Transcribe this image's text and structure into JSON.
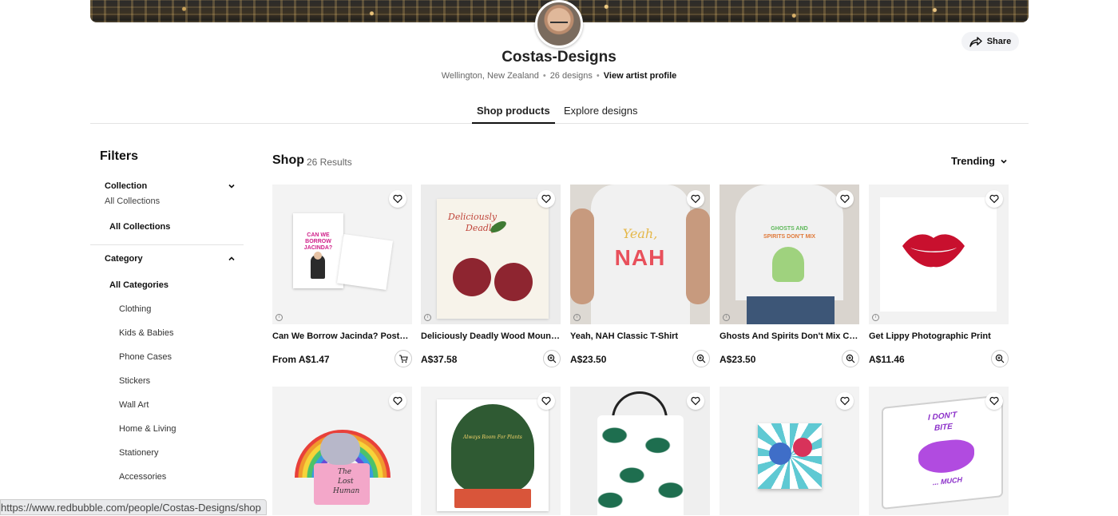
{
  "header": {
    "artist_name": "Costas-Designs",
    "location": "Wellington, New Zealand",
    "design_count": "26 designs",
    "profile_link": "View artist profile",
    "share_label": "Share"
  },
  "tabs": [
    {
      "label": "Shop products",
      "active": true
    },
    {
      "label": "Explore designs",
      "active": false
    }
  ],
  "sidebar": {
    "heading": "Filters",
    "collection": {
      "label": "Collection",
      "current": "All Collections",
      "link": "All Collections"
    },
    "category": {
      "label": "Category",
      "all": "All Categories",
      "items": [
        "Clothing",
        "Kids & Babies",
        "Phone Cases",
        "Stickers",
        "Wall Art",
        "Home & Living",
        "Stationery",
        "Accessories"
      ]
    }
  },
  "shop": {
    "heading": "Shop",
    "results": "26 Results",
    "sort": "Trending"
  },
  "products": [
    {
      "name": "Can We Borrow Jacinda? Postcard",
      "price": "From A$1.47",
      "action": "cart-icon"
    },
    {
      "name": "Deliciously Deadly Wood Mounted Print",
      "price": "A$37.58",
      "action": "zoom-icon"
    },
    {
      "name": "Yeah, NAH Classic T-Shirt",
      "price": "A$23.50",
      "action": "zoom-icon"
    },
    {
      "name": "Ghosts And Spirits Don't Mix Classic T-Shirt",
      "price": "A$23.50",
      "action": "zoom-icon"
    },
    {
      "name": "Get Lippy Photographic Print",
      "price": "A$11.46",
      "action": "zoom-icon"
    }
  ],
  "product_art": {
    "p1_text": "CAN WE BORROW JACINDA?",
    "p2_text1": "Deliciously",
    "p2_text2": "Deadly",
    "p3_text1": "Yeah,",
    "p3_text2": "NAH",
    "p4_text1": "GHOSTS AND",
    "p4_text2": "SPIRITS DON'T MIX",
    "r2_p1_text1": "The",
    "r2_p1_text2": "Lost",
    "r2_p1_text3": "Human",
    "r2_p2_text": "Always Room For Plants",
    "r2_p5_text1": "I DON'T",
    "r2_p5_text2": "BITE",
    "r2_p5_text3": "... MUCH"
  },
  "status_url": "https://www.redbubble.com/people/Costas-Designs/shop",
  "colors": {
    "accent": "#111111",
    "divider": "#e3e3e3",
    "lips": "#c8102e"
  }
}
